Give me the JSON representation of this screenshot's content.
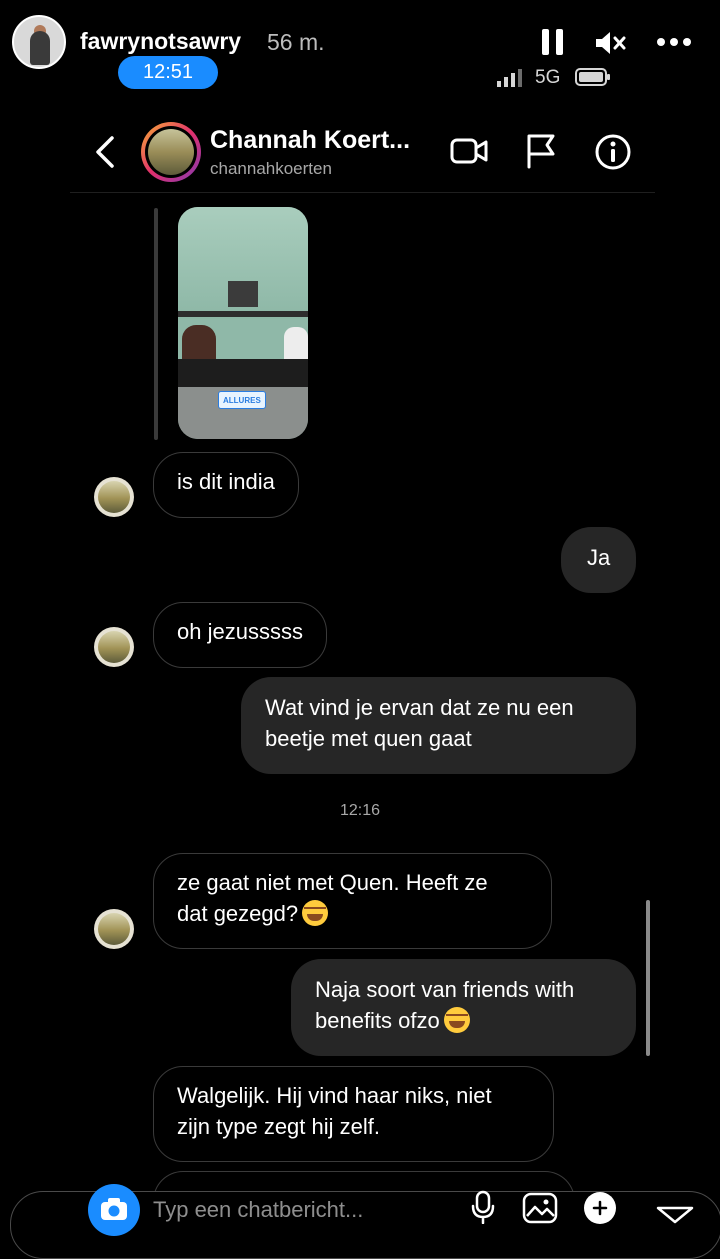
{
  "story": {
    "username": "fawrynotsawry",
    "age": "56 m.",
    "time": "12:51",
    "network": "5G",
    "icons": [
      "pause-icon",
      "mute-icon",
      "more-icon",
      "signal-icon",
      "battery-icon"
    ]
  },
  "thread": {
    "name": "Channah Koert...",
    "handle": "channahkoerten",
    "icons": [
      "back-icon",
      "video-call-icon",
      "flag-icon",
      "info-icon"
    ]
  },
  "shared_media": {
    "tag": "ALLURES"
  },
  "messages": [
    {
      "side": "in",
      "text": "is dit india"
    },
    {
      "side": "out",
      "text": "Ja"
    },
    {
      "side": "in",
      "text": "oh jezusssss"
    },
    {
      "side": "out",
      "lines": [
        "Wat vind je ervan dat ze nu een",
        "beetje met quen gaat"
      ]
    },
    {
      "side": "in",
      "lines": [
        "ze gaat niet met Quen. Heeft ze",
        "dat gezegd?"
      ],
      "emoji": "joy"
    },
    {
      "side": "out",
      "lines": [
        "Naja soort van friends with",
        "benefits ofzo"
      ],
      "emoji": "rofl"
    },
    {
      "side": "in",
      "lines": [
        "Walgelijk. Hij vind haar niks, niet",
        "zijn type zegt hij zelf."
      ]
    }
  ],
  "timestamp": "12:16",
  "composer": {
    "placeholder": "Typ een chatbericht..."
  },
  "colors": {
    "background": "#000000",
    "outgoing_bubble": "#262626",
    "incoming_border": "#3a3a3a",
    "accent_blue": "#1a8cff"
  }
}
